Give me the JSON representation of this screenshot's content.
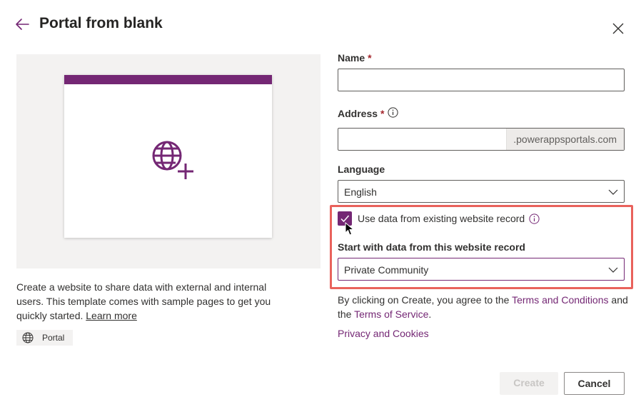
{
  "header": {
    "title": "Portal from blank"
  },
  "preview": {
    "accent_color": "#742774",
    "icon": "globe-plus-icon"
  },
  "description": {
    "text": "Create a website to share data with external and internal users. This template comes with sample pages to get you quickly started.",
    "learn_more": "Learn more"
  },
  "tag": {
    "icon": "globe-icon",
    "label": "Portal"
  },
  "form": {
    "name": {
      "label": "Name",
      "required": "*",
      "value": ""
    },
    "address": {
      "label": "Address",
      "required": "*",
      "value": "",
      "suffix": ".powerappsportals.com"
    },
    "language": {
      "label": "Language",
      "selected": "English"
    },
    "use_existing": {
      "label": "Use data from existing website record",
      "checked": true
    },
    "start_with": {
      "label": "Start with data from this website record",
      "selected": "Private Community"
    },
    "terms": {
      "prefix": "By clicking on Create, you agree to the",
      "terms_link": "Terms and Conditions",
      "middle": "and the",
      "service_link": "Terms of Service",
      "suffix": "."
    },
    "privacy_link": "Privacy and Cookies"
  },
  "actions": {
    "create": "Create",
    "cancel": "Cancel"
  },
  "colors": {
    "brand": "#742774",
    "highlight": "#e9625c"
  }
}
